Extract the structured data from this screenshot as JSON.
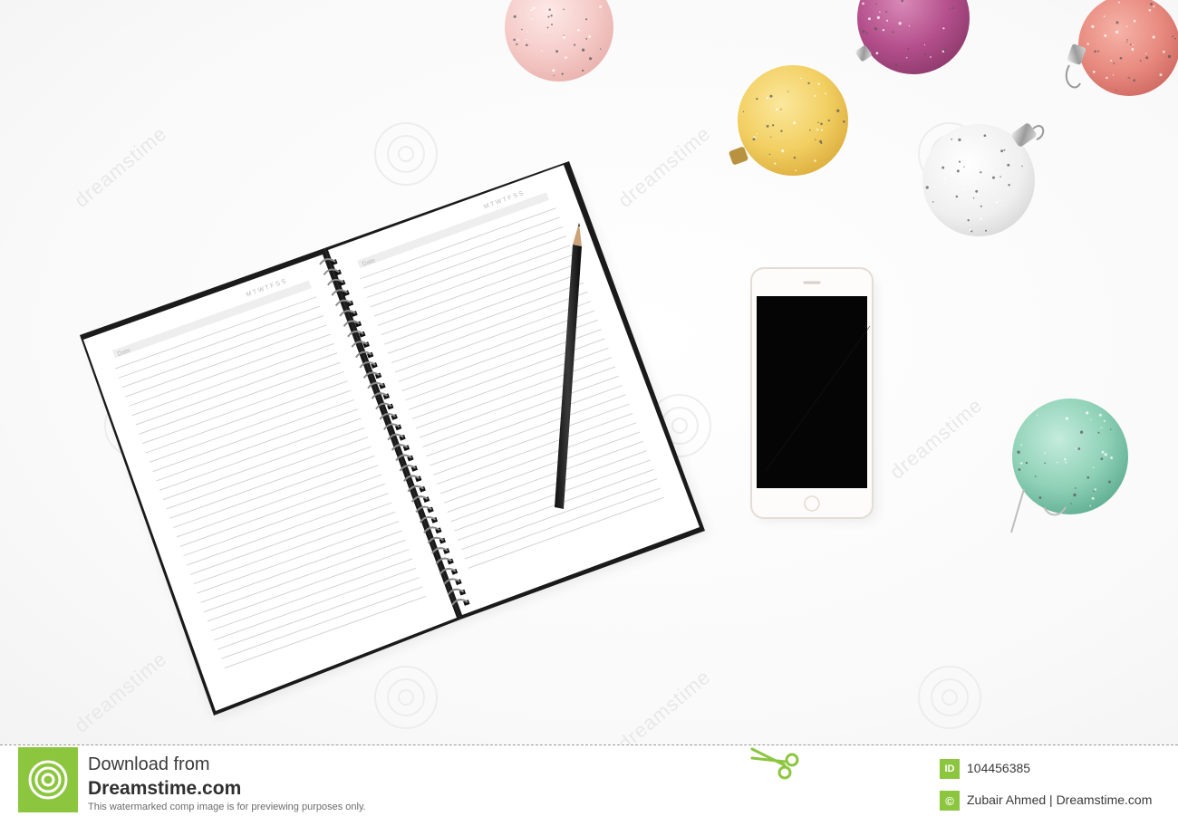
{
  "scene": {
    "notebook": {
      "left_page_week": "M T W T F S S",
      "left_page_date": "Date",
      "right_page_week": "M T W T F S S",
      "right_page_date": "Date"
    },
    "phone_screen_color": "#000000",
    "ornament_colors": [
      "#f3c7c7",
      "#b54f8e",
      "#f1cf62",
      "#e88a7f",
      "#eeeeee",
      "#8fd1b7"
    ],
    "watermark_text": "dreamstime"
  },
  "footer": {
    "download_label": "Download from",
    "site_label": "Dreamstime.com",
    "preview_note": "This watermarked comp image is for previewing purposes only.",
    "id_badge": "ID",
    "image_id": "104456385",
    "copyright_badge": "©",
    "credit": "Zubair Ahmed | Dreamstime.com",
    "brand_color": "#8cc63f"
  }
}
